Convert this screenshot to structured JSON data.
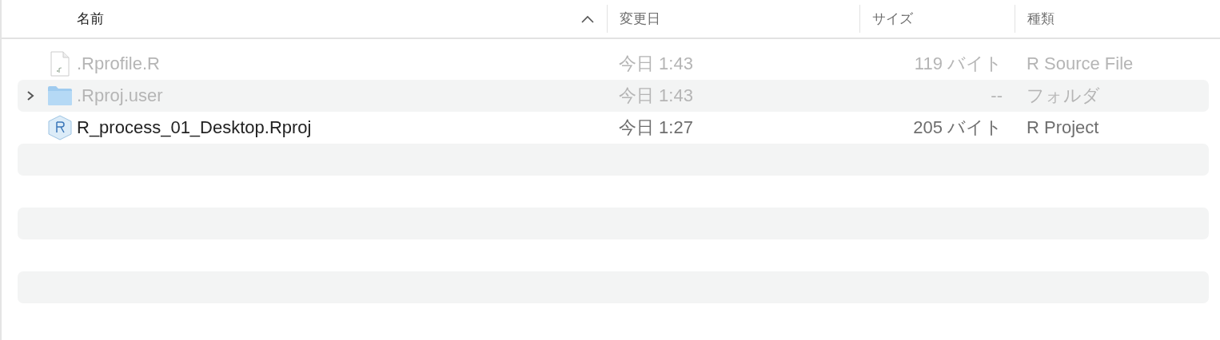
{
  "columns": [
    {
      "label": "名前",
      "sorted": true
    },
    {
      "label": "変更日",
      "sorted": false
    },
    {
      "label": "サイズ",
      "sorted": false
    },
    {
      "label": "種類",
      "sorted": false
    }
  ],
  "rows": [
    {
      "kind": "r-file",
      "name": ".Rprofile.R",
      "hidden": true,
      "date": "今日 1:43",
      "size": "119 バイト",
      "type": "R Source File"
    },
    {
      "kind": "folder",
      "name": ".Rproj.user",
      "hidden": true,
      "expanded": false,
      "date": "今日 1:43",
      "size": "--",
      "type": "フォルダ"
    },
    {
      "kind": "rproj",
      "name": "R_process_01_Desktop.Rproj",
      "hidden": false,
      "date": "今日 1:27",
      "size": "205 バイト",
      "type": "R Project"
    }
  ]
}
